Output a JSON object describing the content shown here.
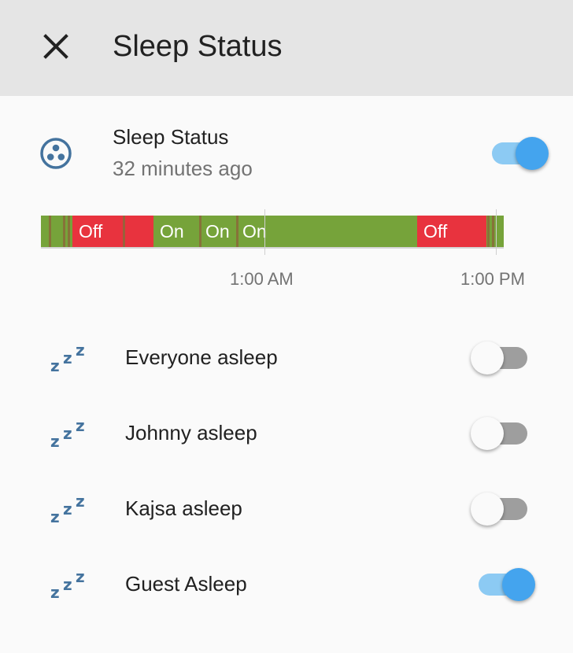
{
  "header": {
    "title": "Sleep Status",
    "close_icon": "close-icon"
  },
  "master": {
    "name": "Sleep Status",
    "last_changed": "32 minutes ago",
    "icon": "google-circles-communities-icon",
    "state": "on"
  },
  "history": {
    "segments": [
      {
        "state": "on",
        "label": ""
      },
      {
        "state": "off",
        "label": "Off"
      },
      {
        "state": "on",
        "label": "On"
      },
      {
        "state": "on",
        "label": "On"
      },
      {
        "state": "on",
        "label": "On"
      },
      {
        "state": "off",
        "label": "Off"
      },
      {
        "state": "on",
        "label": ""
      }
    ],
    "ticks": [
      "1:00 AM",
      "1:00 PM"
    ],
    "colors": {
      "on": "#76a33a",
      "off": "#e8333e"
    }
  },
  "entities": [
    {
      "name": "Everyone asleep",
      "icon": "sleep-zzz-icon",
      "state": "off"
    },
    {
      "name": "Johnny asleep",
      "icon": "sleep-zzz-icon",
      "state": "off"
    },
    {
      "name": "Kajsa asleep",
      "icon": "sleep-zzz-icon",
      "state": "off"
    },
    {
      "name": "Guest Asleep",
      "icon": "sleep-zzz-icon",
      "state": "on"
    }
  ],
  "colors": {
    "header_bg": "#e5e5e5",
    "accent": "#44a4ee",
    "icon": "#44739e"
  }
}
